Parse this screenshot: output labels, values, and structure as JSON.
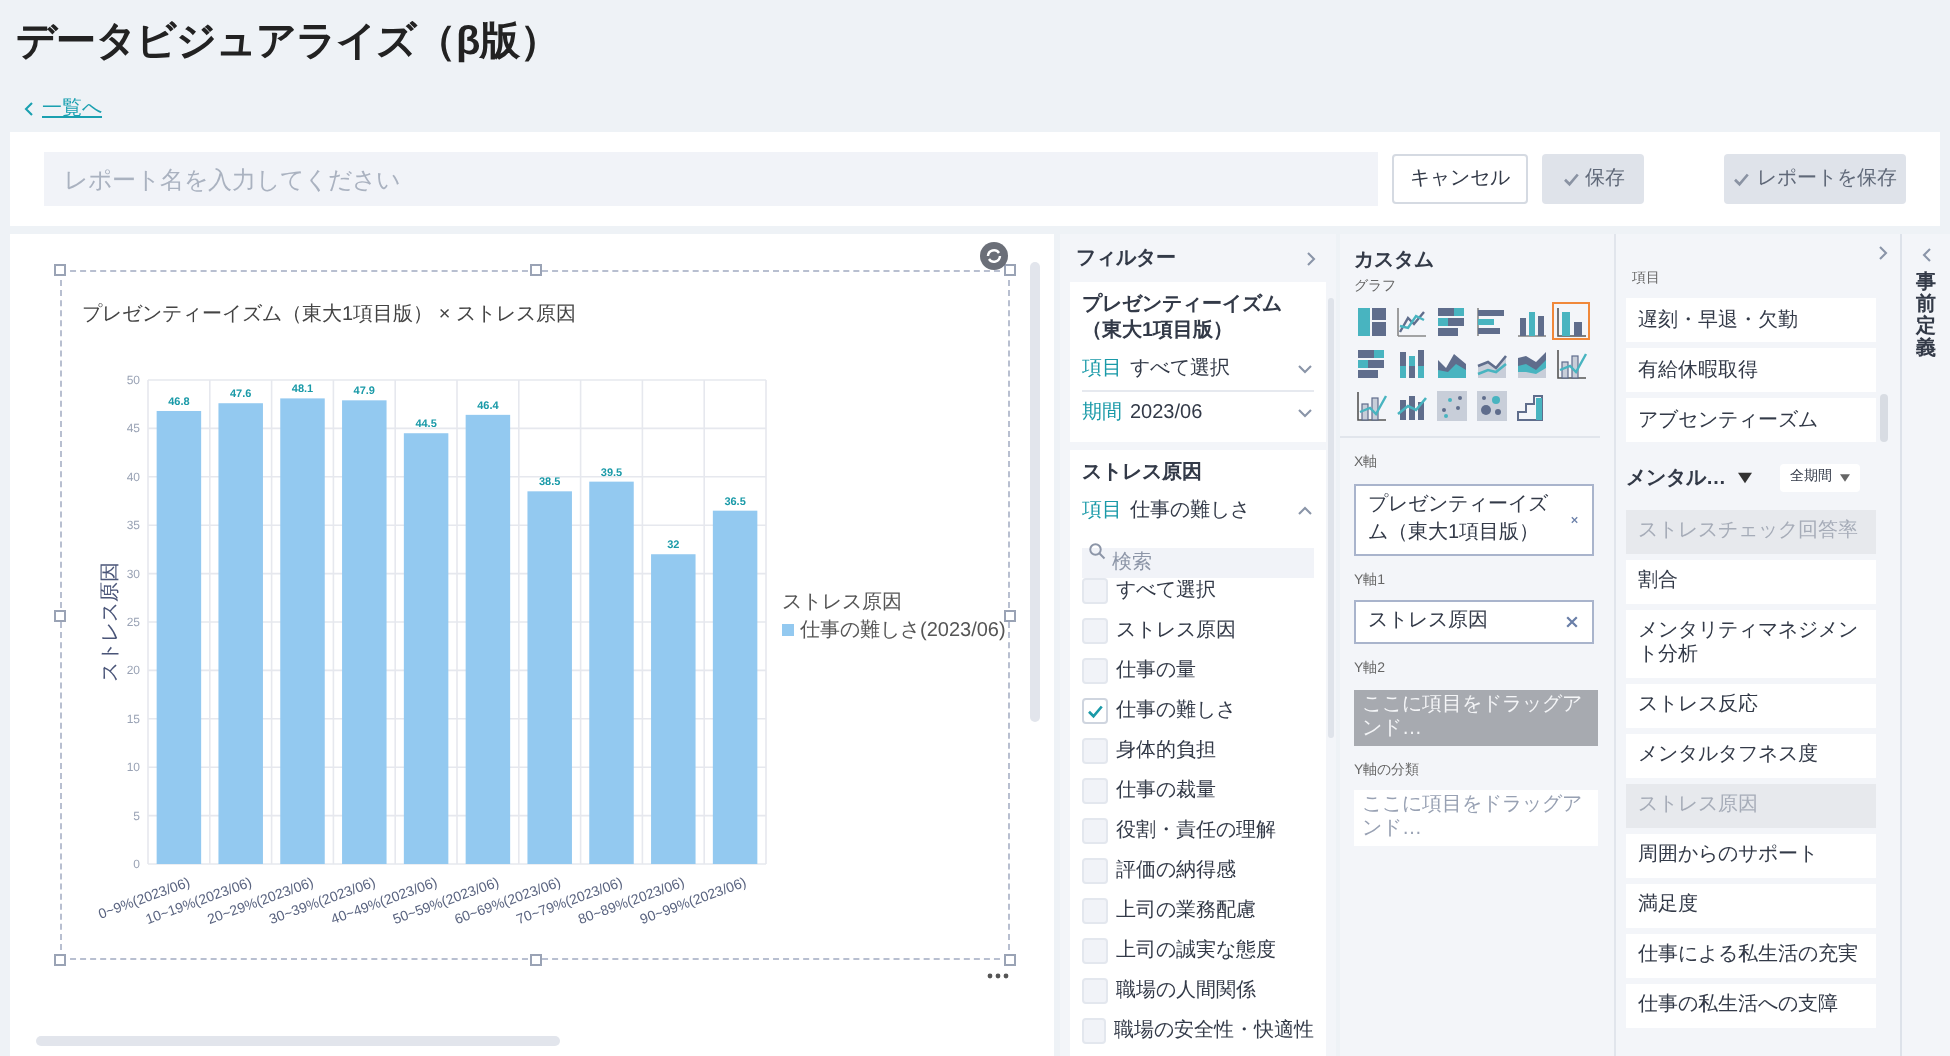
{
  "page_title": "データビジュアライズ（β版）",
  "back_link": "一覧へ",
  "toolbar": {
    "report_name_placeholder": "レポート名を入力してください",
    "cancel": "キャンセル",
    "save": "保存",
    "save_report": "レポートを保存",
    "save_disabled": true
  },
  "chart": {
    "legend_title": "ストレス原因",
    "chart_data": {
      "type": "bar",
      "title": "プレゼンティーイズム（東大1項目版） × ストレス原因",
      "ylabel": "ストレス原因",
      "categories": [
        "0~9%(2023/06)",
        "10~19%(2023/06)",
        "20~29%(2023/06)",
        "30~39%(2023/06)",
        "40~49%(2023/06)",
        "50~59%(2023/06)",
        "60~69%(2023/06)",
        "70~79%(2023/06)",
        "80~89%(2023/06)",
        "90~99%(2023/06)"
      ],
      "series": [
        {
          "name": "仕事の難しさ(2023/06)",
          "color": "#93c9f0",
          "values": [
            46.8,
            47.6,
            48.1,
            47.9,
            44.5,
            46.4,
            38.5,
            39.5,
            32,
            36.5
          ]
        }
      ],
      "grid": true,
      "ylim": [
        0,
        50
      ],
      "yticks": [
        0,
        5,
        10,
        15,
        20,
        25,
        30,
        35,
        40,
        45,
        50
      ],
      "data_labels": true
    }
  },
  "filter": {
    "title": "フィルター",
    "groups": [
      {
        "title": "プレゼンティーイズム（東大1項目版）",
        "fields": [
          {
            "label": "項目",
            "value": "すべて選択",
            "expanded": false
          },
          {
            "label": "期間",
            "value": "2023/06",
            "expanded": false
          }
        ]
      },
      {
        "title": "ストレス原因",
        "fields": [
          {
            "label": "項目",
            "value": "仕事の難しさ",
            "expanded": true
          }
        ],
        "search_placeholder": "検索",
        "options": [
          {
            "label": "すべて選択",
            "checked": false
          },
          {
            "label": "ストレス原因",
            "checked": false
          },
          {
            "label": "仕事の量",
            "checked": false
          },
          {
            "label": "仕事の難しさ",
            "checked": true
          },
          {
            "label": "身体的負担",
            "checked": false
          },
          {
            "label": "仕事の裁量",
            "checked": false
          },
          {
            "label": "役割・責任の理解",
            "checked": false
          },
          {
            "label": "評価の納得感",
            "checked": false
          },
          {
            "label": "上司の業務配慮",
            "checked": false
          },
          {
            "label": "上司の誠実な態度",
            "checked": false
          },
          {
            "label": "職場の人間関係",
            "checked": false
          },
          {
            "label": "職場の安全性・快適性",
            "checked": false
          }
        ]
      }
    ]
  },
  "custom": {
    "title": "カスタム",
    "graph_label": "グラフ",
    "chart_types": [
      {
        "kind": "table",
        "selected": false
      },
      {
        "kind": "line",
        "selected": false
      },
      {
        "kind": "stacked-hbar",
        "selected": false
      },
      {
        "kind": "hbar",
        "selected": false
      },
      {
        "kind": "grouped-column",
        "selected": false
      },
      {
        "kind": "column",
        "selected": true
      },
      {
        "kind": "stacked-hbar",
        "selected": false
      },
      {
        "kind": "stacked-column",
        "selected": false
      },
      {
        "kind": "area",
        "selected": false
      },
      {
        "kind": "line-area",
        "selected": false
      },
      {
        "kind": "stacked-area",
        "selected": false
      },
      {
        "kind": "column-line",
        "selected": false
      },
      {
        "kind": "column-line",
        "selected": false
      },
      {
        "kind": "stacked-column-line",
        "selected": false
      },
      {
        "kind": "scatter",
        "selected": false
      },
      {
        "kind": "bubble",
        "selected": false
      },
      {
        "kind": "step",
        "selected": false
      }
    ],
    "axes": [
      {
        "label": "X軸",
        "value": "プレゼンティーイズム（東大1項目版）"
      },
      {
        "label": "Y軸1",
        "value": "ストレス原因"
      },
      {
        "label": "Y軸2",
        "placeholder": "ここに項目をドラッグアンド…",
        "disabled": true
      },
      {
        "label": "Y軸の分類",
        "placeholder": "ここに項目をドラッグアンド…",
        "disabled": false
      }
    ]
  },
  "items": {
    "label": "項目",
    "top_items": [
      "遅刻・早退・欠勤",
      "有給休暇取得",
      "アブセンティーズム"
    ],
    "category": "メンタル…",
    "period": "全期間",
    "list": [
      {
        "label": "ストレスチェック回答率",
        "disabled": true
      },
      {
        "label": "割合",
        "disabled": false
      },
      {
        "label": "メンタリティマネジメント分析",
        "disabled": false
      },
      {
        "label": "ストレス反応",
        "disabled": false
      },
      {
        "label": "メンタルタフネス度",
        "disabled": false
      },
      {
        "label": "ストレス原因",
        "disabled": true
      },
      {
        "label": "周囲からのサポート",
        "disabled": false
      },
      {
        "label": "満足度",
        "disabled": false
      },
      {
        "label": "仕事による私生活の充実",
        "disabled": false
      },
      {
        "label": "仕事の私生活への支障",
        "disabled": false
      }
    ]
  },
  "side_tab": "事前定義"
}
